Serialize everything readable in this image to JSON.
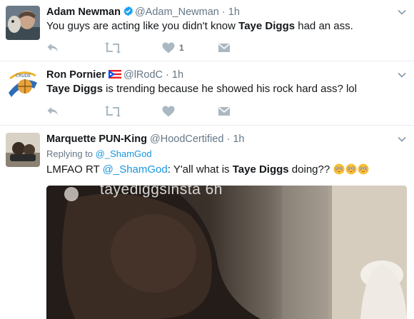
{
  "tweets": [
    {
      "name": "Adam Newman",
      "handle": "@Adam_Newman",
      "separator": "·",
      "time": "1h",
      "verified": true,
      "text_parts": [
        "You guys are acting like you didn't know ",
        "Taye Diggs",
        " had an ass."
      ],
      "like_count": "1"
    },
    {
      "name": "Ron Pornier",
      "handle": "@lRodC",
      "separator": "·",
      "time": "1h",
      "flag": "puerto-rico-flag",
      "text_parts": [
        "Taye Diggs",
        " is trending because he showed his rock hard ass? lol"
      ]
    },
    {
      "name": "Marquette PUN-King",
      "handle": "@HoodCertified",
      "separator": "·",
      "time": "1h",
      "replying_prefix": "Replying to ",
      "replying_handle": "@_ShamGod",
      "text_parts": [
        "LMFAO RT ",
        "@_ShamGod",
        ": Y'all what is ",
        "Taye Diggs",
        " doing??"
      ],
      "emoji": "flushed-face-emoji",
      "photo_caption": "tayediggsinsta  6h"
    }
  ],
  "colors": {
    "text": "#14171a",
    "muted": "#657786",
    "link": "#1b95e0",
    "verified": "#1da1f2",
    "icon": "#aab8c2",
    "divider": "#e6ecf0"
  }
}
